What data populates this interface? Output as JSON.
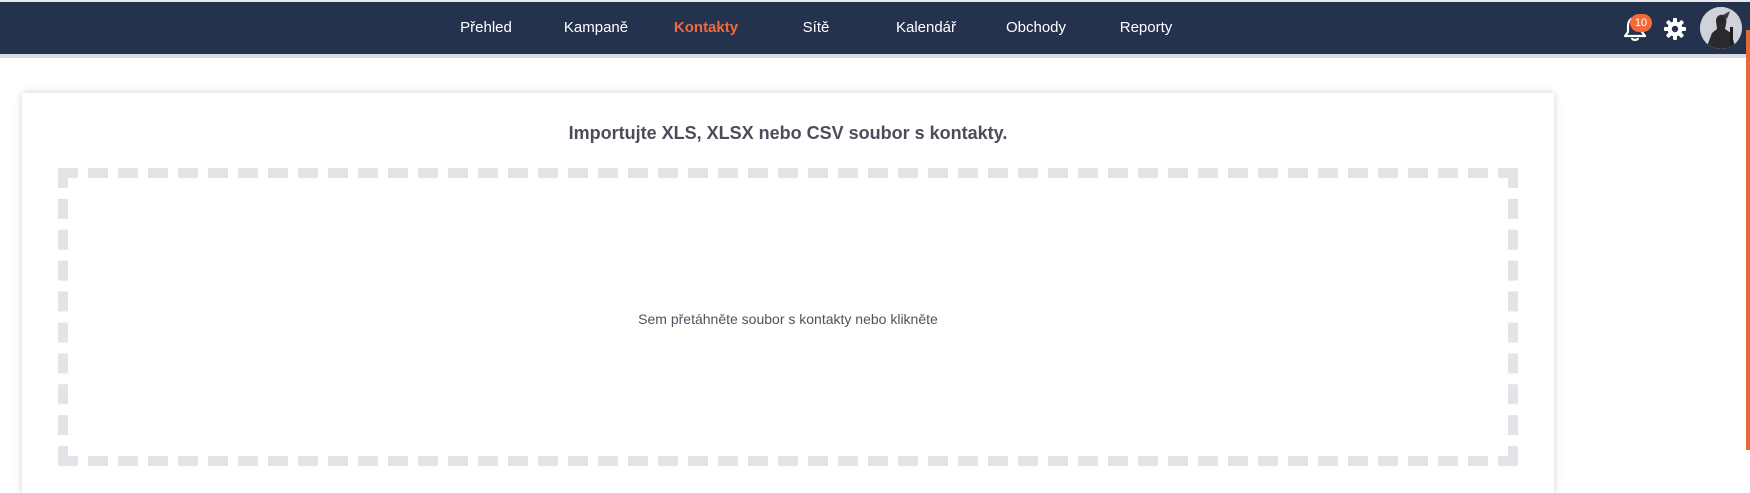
{
  "nav": {
    "items": [
      {
        "label": "Přehled",
        "active": false
      },
      {
        "label": "Kampaně",
        "active": false
      },
      {
        "label": "Kontakty",
        "active": true
      },
      {
        "label": "Sítě",
        "active": false
      },
      {
        "label": "Kalendář",
        "active": false
      },
      {
        "label": "Obchody",
        "active": false
      },
      {
        "label": "Reporty",
        "active": false
      }
    ]
  },
  "header": {
    "notifications_count": "10",
    "notification_icon": "bell-icon",
    "settings_icon": "gear-icon",
    "avatar_icon": "user-avatar"
  },
  "import": {
    "title": "Importujte XLS, XLSX nebo CSV soubor s kontakty.",
    "dropzone_text": "Sem přetáhněte soubor s kontakty nebo klikněte"
  },
  "colors": {
    "topbar": "#25324d",
    "accent": "#f26a3a",
    "dropzone_border": "#e3e4e8"
  }
}
